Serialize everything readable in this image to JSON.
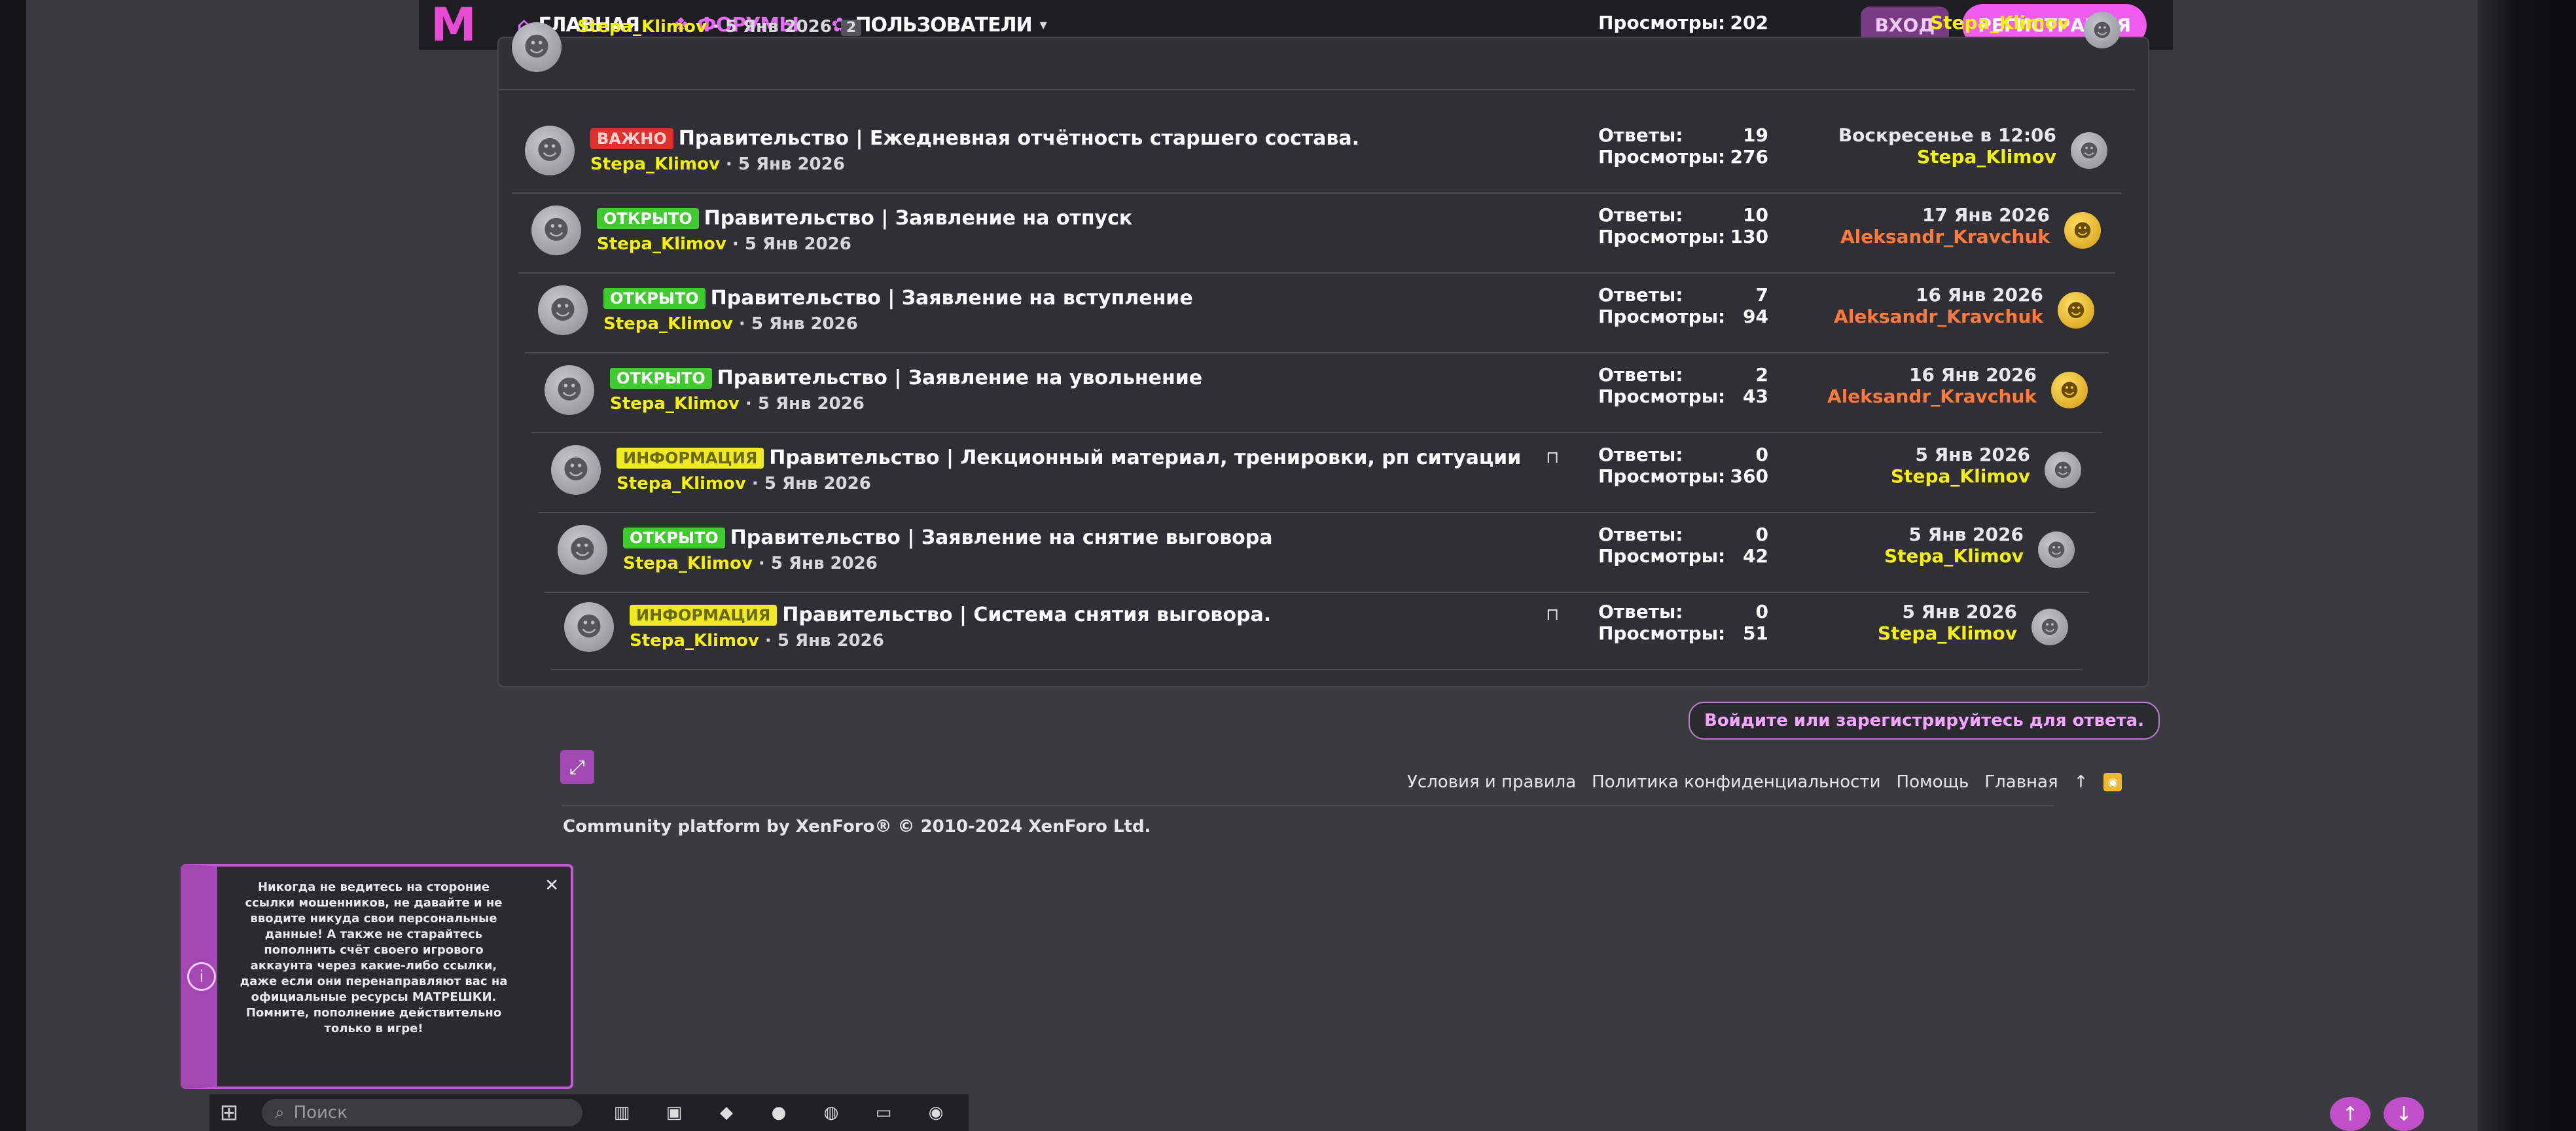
{
  "nav": {
    "logo": "M",
    "home_label": "ГЛАВНАЯ",
    "forums_label": "ФОРУМЫ",
    "users_label": "ПОЛЬЗОВАТЕЛИ",
    "login_label": "ВХОД",
    "register_label": "РЕГИСТРАЦИЯ"
  },
  "threads": [
    {
      "badge": "",
      "badge_color": "",
      "title": "",
      "author": "Stepa_Klimov",
      "date": "· 5 Янв 2026",
      "pages": "2",
      "locked": false,
      "replies_label": "",
      "replies": "",
      "views_label": "Просмотры:",
      "views": "202",
      "last_date": "",
      "last_user": "Stepa_Klimov",
      "last_user_color": "yellow",
      "last_avatar": "grey"
    },
    {
      "badge": "ВАЖНО",
      "badge_color": "red",
      "title": "Правительство | Ежедневная отчётность старшего состава.",
      "author": "Stepa_Klimov",
      "date": "· 5 Янв 2026",
      "locked": false,
      "replies_label": "Ответы:",
      "replies": "19",
      "views_label": "Просмотры:",
      "views": "276",
      "last_date": "Воскресенье в 12:06",
      "last_user": "Stepa_Klimov",
      "last_user_color": "yellow",
      "last_avatar": "grey"
    },
    {
      "badge": "ОТКРЫТО",
      "badge_color": "green",
      "title": "Правительство | Заявление на отпуск",
      "author": "Stepa_Klimov",
      "date": "· 5 Янв 2026",
      "locked": false,
      "replies_label": "Ответы:",
      "replies": "10",
      "views_label": "Просмотры:",
      "views": "130",
      "last_date": "17 Янв 2026",
      "last_user": "Aleksandr_Kravchuk",
      "last_user_color": "orange",
      "last_avatar": "gold"
    },
    {
      "badge": "ОТКРЫТО",
      "badge_color": "green",
      "title": "Правительство | Заявление на вступление",
      "author": "Stepa_Klimov",
      "date": "· 5 Янв 2026",
      "locked": false,
      "replies_label": "Ответы:",
      "replies": "7",
      "views_label": "Просмотры:",
      "views": "94",
      "last_date": "16 Янв 2026",
      "last_user": "Aleksandr_Kravchuk",
      "last_user_color": "orange",
      "last_avatar": "gold"
    },
    {
      "badge": "ОТКРЫТО",
      "badge_color": "green",
      "title": "Правительство | Заявление на увольнение",
      "author": "Stepa_Klimov",
      "date": "· 5 Янв 2026",
      "locked": false,
      "replies_label": "Ответы:",
      "replies": "2",
      "views_label": "Просмотры:",
      "views": "43",
      "last_date": "16 Янв 2026",
      "last_user": "Aleksandr_Kravchuk",
      "last_user_color": "orange",
      "last_avatar": "gold"
    },
    {
      "badge": "ИНФОРМАЦИЯ",
      "badge_color": "yellow",
      "title": "Правительство | Лекционный материал, тренировки, рп ситуации",
      "author": "Stepa_Klimov",
      "date": "· 5 Янв 2026",
      "locked": true,
      "replies_label": "Ответы:",
      "replies": "0",
      "views_label": "Просмотры:",
      "views": "360",
      "last_date": "5 Янв 2026",
      "last_user": "Stepa_Klimov",
      "last_user_color": "yellow",
      "last_avatar": "grey"
    },
    {
      "badge": "ОТКРЫТО",
      "badge_color": "green",
      "title": "Правительство | Заявление на снятие выговора",
      "author": "Stepa_Klimov",
      "date": "· 5 Янв 2026",
      "locked": false,
      "replies_label": "Ответы:",
      "replies": "0",
      "views_label": "Просмотры:",
      "views": "42",
      "last_date": "5 Янв 2026",
      "last_user": "Stepa_Klimov",
      "last_user_color": "yellow",
      "last_avatar": "grey"
    },
    {
      "badge": "ИНФОРМАЦИЯ",
      "badge_color": "yellow",
      "title": "Правительство | Система снятия выговора.",
      "author": "Stepa_Klimov",
      "date": "· 5 Янв 2026",
      "locked": true,
      "replies_label": "Ответы:",
      "replies": "0",
      "views_label": "Просмотры:",
      "views": "51",
      "last_date": "5 Янв 2026",
      "last_user": "Stepa_Klimov",
      "last_user_color": "yellow",
      "last_avatar": "grey"
    }
  ],
  "reply_prompt": "Войдите или зарегистрируйтесь для ответа.",
  "footer": {
    "links": [
      "Условия и правила",
      "Политика конфиденциальности",
      "Помощь",
      "Главная"
    ],
    "copyright": "Community platform by XenForo® © 2010-2024 XenForo Ltd."
  },
  "notice": {
    "text": "Никогда не ведитесь на стороние ссылки мошенников, не давайте и не вводите никуда свои персональные данные! А также не старайтесь пополнить счёт своего игрового аккаунта через какие-либо ссылки, даже если они перенаправляют вас на официальные ресурсы МАТРЕШКИ. Помните, пополнение действительно только в игре!"
  },
  "taskbar": {
    "search_placeholder": "Поиск"
  },
  "colors": {
    "accent": "#e64bd2",
    "author_yellow": "#f4f00a",
    "author_orange": "#ff7a3a"
  }
}
